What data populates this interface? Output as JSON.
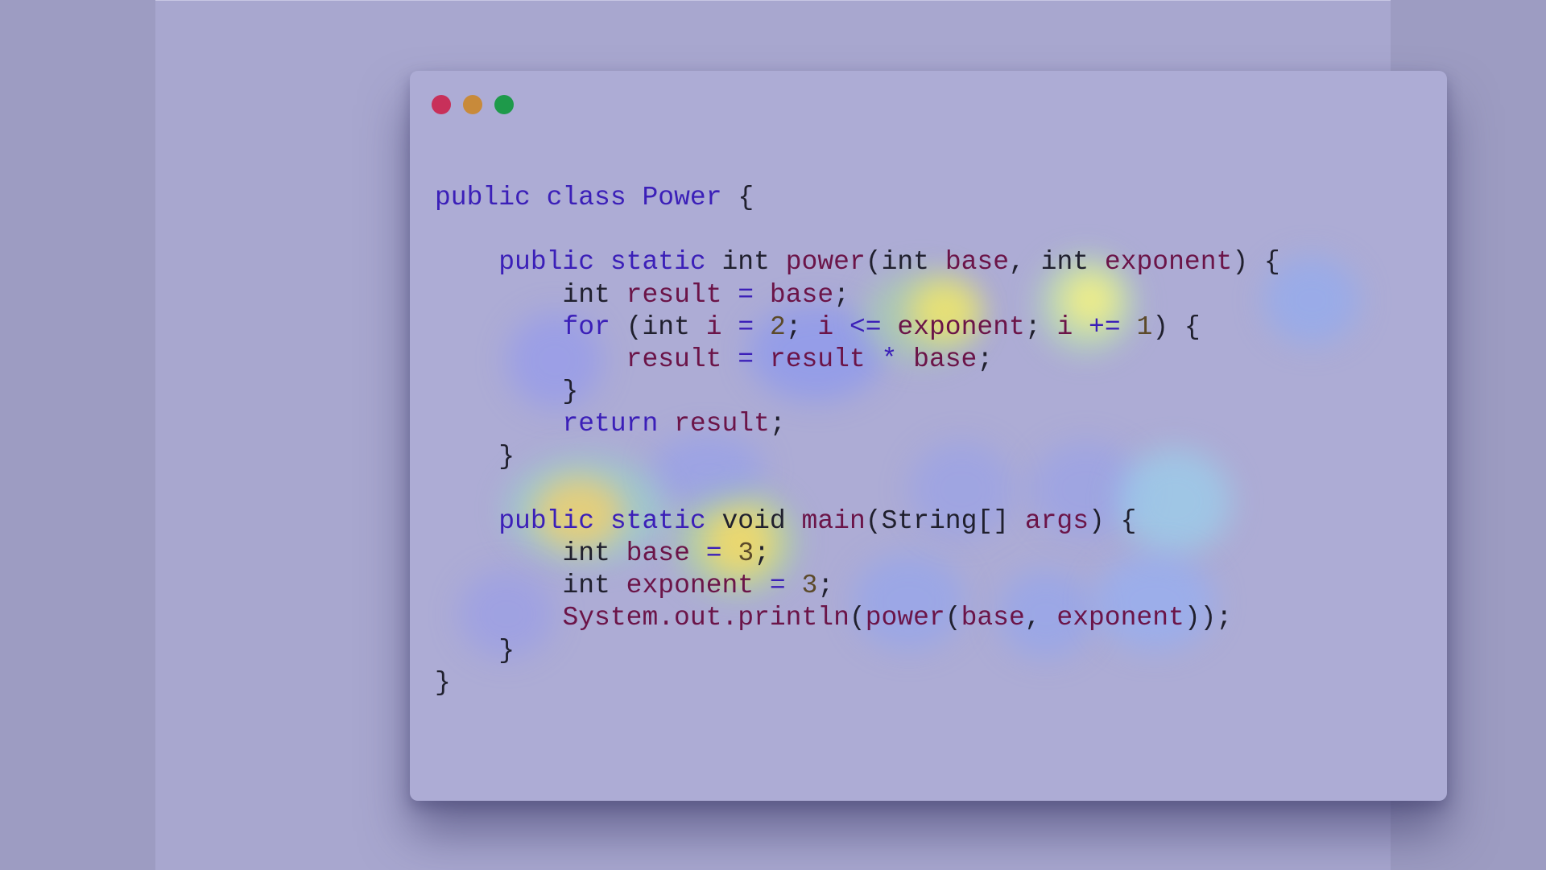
{
  "window": {
    "traffic_lights": [
      {
        "name": "close",
        "color": "#c8305a"
      },
      {
        "name": "minimize",
        "color": "#c88a3a"
      },
      {
        "name": "zoom",
        "color": "#1e9a4a"
      }
    ]
  },
  "code": {
    "language": "java",
    "lines": [
      [
        {
          "t": "public",
          "c": "kw"
        },
        {
          "t": " "
        },
        {
          "t": "class",
          "c": "kw"
        },
        {
          "t": " "
        },
        {
          "t": "Power",
          "c": "cls"
        },
        {
          "t": " {"
        }
      ],
      [],
      [
        {
          "t": "    "
        },
        {
          "t": "public",
          "c": "kw"
        },
        {
          "t": " "
        },
        {
          "t": "static",
          "c": "kw"
        },
        {
          "t": " "
        },
        {
          "t": "int",
          "c": "typ"
        },
        {
          "t": " "
        },
        {
          "t": "power",
          "c": "ident"
        },
        {
          "t": "("
        },
        {
          "t": "int",
          "c": "typ"
        },
        {
          "t": " "
        },
        {
          "t": "base",
          "c": "ident"
        },
        {
          "t": ", "
        },
        {
          "t": "int",
          "c": "typ"
        },
        {
          "t": " "
        },
        {
          "t": "exponent",
          "c": "ident"
        },
        {
          "t": ") {"
        }
      ],
      [
        {
          "t": "        "
        },
        {
          "t": "int",
          "c": "typ"
        },
        {
          "t": " "
        },
        {
          "t": "result",
          "c": "ident"
        },
        {
          "t": " = ",
          "c": "op"
        },
        {
          "t": "base",
          "c": "ident"
        },
        {
          "t": ";"
        }
      ],
      [
        {
          "t": "        "
        },
        {
          "t": "for",
          "c": "kw"
        },
        {
          "t": " ("
        },
        {
          "t": "int",
          "c": "typ"
        },
        {
          "t": " "
        },
        {
          "t": "i",
          "c": "ident"
        },
        {
          "t": " = ",
          "c": "op"
        },
        {
          "t": "2",
          "c": "num"
        },
        {
          "t": "; "
        },
        {
          "t": "i",
          "c": "ident"
        },
        {
          "t": " <= ",
          "c": "op"
        },
        {
          "t": "exponent",
          "c": "ident"
        },
        {
          "t": "; "
        },
        {
          "t": "i",
          "c": "ident"
        },
        {
          "t": " += ",
          "c": "op"
        },
        {
          "t": "1",
          "c": "num"
        },
        {
          "t": ") {"
        }
      ],
      [
        {
          "t": "            "
        },
        {
          "t": "result",
          "c": "ident"
        },
        {
          "t": " = ",
          "c": "op"
        },
        {
          "t": "result",
          "c": "ident"
        },
        {
          "t": " * ",
          "c": "op"
        },
        {
          "t": "base",
          "c": "ident"
        },
        {
          "t": ";"
        }
      ],
      [
        {
          "t": "        }"
        }
      ],
      [
        {
          "t": "        "
        },
        {
          "t": "return",
          "c": "kw"
        },
        {
          "t": " "
        },
        {
          "t": "result",
          "c": "ident"
        },
        {
          "t": ";"
        }
      ],
      [
        {
          "t": "    }"
        }
      ],
      [],
      [
        {
          "t": "    "
        },
        {
          "t": "public",
          "c": "kw"
        },
        {
          "t": " "
        },
        {
          "t": "static",
          "c": "kw"
        },
        {
          "t": " "
        },
        {
          "t": "void",
          "c": "typ"
        },
        {
          "t": " "
        },
        {
          "t": "main",
          "c": "ident"
        },
        {
          "t": "("
        },
        {
          "t": "String",
          "c": "typ"
        },
        {
          "t": "[] "
        },
        {
          "t": "args",
          "c": "ident"
        },
        {
          "t": ") {"
        }
      ],
      [
        {
          "t": "        "
        },
        {
          "t": "int",
          "c": "typ"
        },
        {
          "t": " "
        },
        {
          "t": "base",
          "c": "ident"
        },
        {
          "t": " = ",
          "c": "op"
        },
        {
          "t": "3",
          "c": "num"
        },
        {
          "t": ";"
        }
      ],
      [
        {
          "t": "        "
        },
        {
          "t": "int",
          "c": "typ"
        },
        {
          "t": " "
        },
        {
          "t": "exponent",
          "c": "ident"
        },
        {
          "t": " = ",
          "c": "op"
        },
        {
          "t": "3",
          "c": "num"
        },
        {
          "t": ";"
        }
      ],
      [
        {
          "t": "        "
        },
        {
          "t": "System.out.println",
          "c": "ident"
        },
        {
          "t": "("
        },
        {
          "t": "power",
          "c": "ident"
        },
        {
          "t": "("
        },
        {
          "t": "base",
          "c": "ident"
        },
        {
          "t": ", "
        },
        {
          "t": "exponent",
          "c": "ident"
        },
        {
          "t": "));"
        }
      ],
      [
        {
          "t": "    }"
        }
      ],
      [
        {
          "t": "}"
        }
      ]
    ]
  }
}
